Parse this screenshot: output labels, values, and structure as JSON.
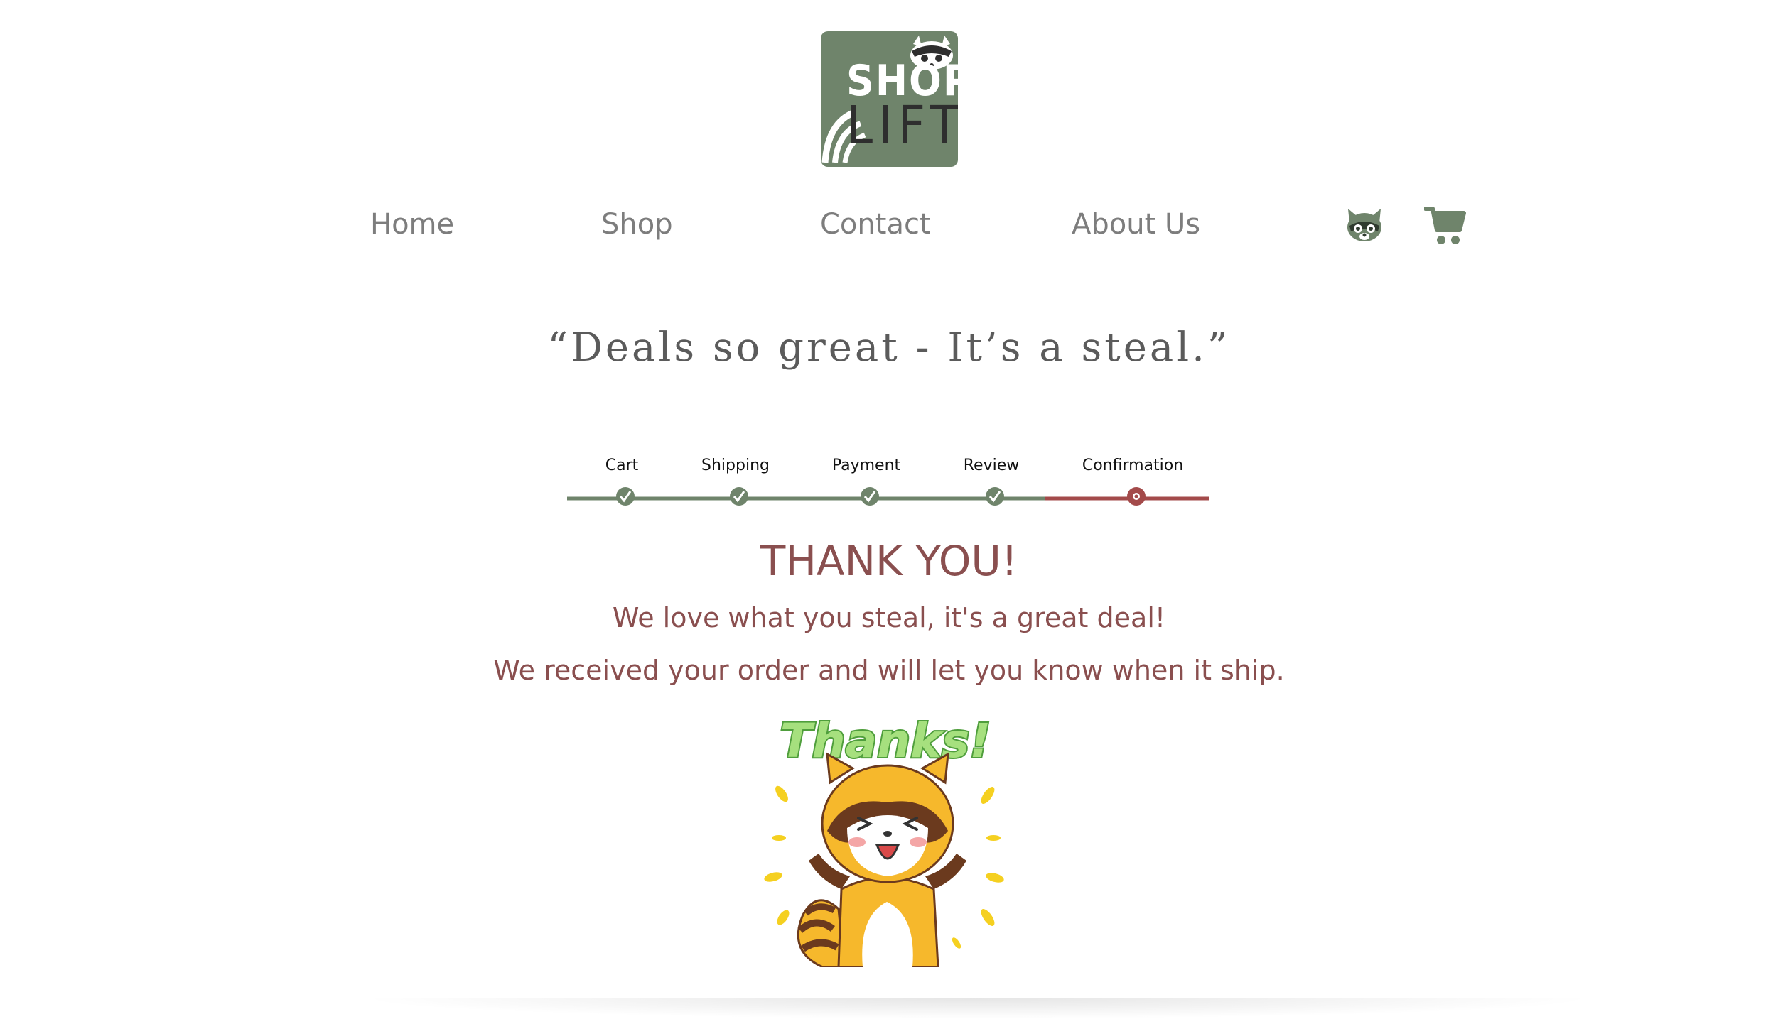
{
  "logo": {
    "line1": "SHOP",
    "line2": "LIFT"
  },
  "nav": {
    "links": [
      "Home",
      "Shop",
      "Contact",
      "About Us"
    ],
    "account_icon": "raccoon-icon",
    "cart_icon": "cart-icon"
  },
  "tagline": "“Deals so great - It’s a steal.”",
  "progress": {
    "steps": [
      "Cart",
      "Shipping",
      "Payment",
      "Review",
      "Confirmation"
    ],
    "completed": 4,
    "current": 5
  },
  "confirmation": {
    "title": "THANK YOU!",
    "line1": "We love what you steal, it's a great deal!",
    "line2": "We received your order and will let you know when it ship.",
    "sticker_text": "Thanks!"
  },
  "colors": {
    "brand_green": "#6f846b",
    "accent_red": "#a34a4a",
    "message_text": "#8a4f4f",
    "nav_text": "#7d7d7d"
  }
}
